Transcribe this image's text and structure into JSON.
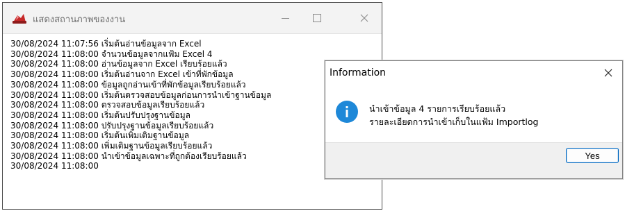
{
  "status_window": {
    "title": "แสดงสถานภาพของงาน",
    "log": [
      "30/08/2024 11:07:56 เริ่มต้นอ่านข้อมูลจาก Excel",
      "30/08/2024 11:08:00 จำนวนข้อมูลจากแฟ้ม Excel 4",
      "30/08/2024 11:08:00 อ่านข้อมูลจาก Excel เรียบร้อยแล้ว",
      "30/08/2024 11:08:00 เริ่มต้นอ่านจาก Excel เข้าที่พักข้อมูล",
      "30/08/2024 11:08:00 ข้อมูลถูกอ่านเข้าที่พักข้อมูลเรียบร้อยแล้ว",
      "30/08/2024 11:08:00 เริ่มต้นตรวจสอบข้อมูลก่อนการนำเข้าฐานข้อมูล",
      "30/08/2024 11:08:00 ตรวจสอบข้อมูลเรียบร้อยแล้ว",
      "30/08/2024 11:08:00 เริ่มต้นปรับปรุงฐานข้อมูล",
      "30/08/2024 11:08:00 ปรับปรุงฐานข้อมูลเรียบร้อยแล้ว",
      "30/08/2024 11:08:00 เริ่มต้นเพิ่มเติมฐานข้อมูล",
      "30/08/2024 11:08:00 เพิ่มเติมฐานข้อมูลเรียบร้อยแล้ว",
      "30/08/2024 11:08:00 นำเข้าข้อมูลเฉพาะที่ถูกต้องเรียบร้อยแล้ว",
      "30/08/2024 11:08:00"
    ]
  },
  "dialog": {
    "title": "Information",
    "message_line1": "นำเข้าข้อมูล 4 รายการเรียบร้อยแล้ว",
    "message_line2": "รายละเอียดการนำเข้าเก็บในแฟ้ม Importlog",
    "yes_label": "Yes"
  },
  "colors": {
    "accent": "#0067c0",
    "info_icon": "#1e88d8",
    "titlebar_bg": "#f3f3f3",
    "dialog_footer_bg": "#f0f0f0"
  },
  "icons": {
    "app": "app-logo-icon",
    "minimize": "minimize-icon",
    "maximize": "maximize-icon",
    "close": "close-icon",
    "info": "info-icon"
  }
}
